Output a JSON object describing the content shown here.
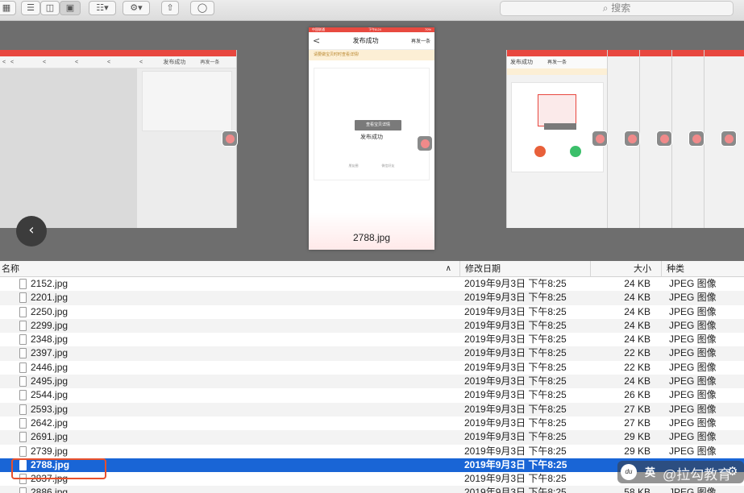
{
  "toolbar": {
    "search_placeholder": "搜索",
    "search_icon": "⌕"
  },
  "coverflow": {
    "caption": "2788.jpg",
    "phone": {
      "title": "发布成功",
      "back": "<",
      "more": "再发一条",
      "status_left": "中国联通",
      "status_time": "下午8:24",
      "status_right": "70%",
      "tip": "请要做宝贝时时查看详情!",
      "view_button": "查看宝贝详情",
      "done_text": "发布成功",
      "link_left": "朋友圈",
      "link_right": "微信好友"
    },
    "back_icon": "‹"
  },
  "columns": {
    "name": "名称",
    "sort_icon": "∧",
    "date": "修改日期",
    "size": "大小",
    "kind": "种类"
  },
  "files": [
    {
      "name": "2152.jpg",
      "date": "2019年9月3日 下午8:25",
      "size": "24 KB",
      "kind": "JPEG 图像"
    },
    {
      "name": "2201.jpg",
      "date": "2019年9月3日 下午8:25",
      "size": "24 KB",
      "kind": "JPEG 图像"
    },
    {
      "name": "2250.jpg",
      "date": "2019年9月3日 下午8:25",
      "size": "24 KB",
      "kind": "JPEG 图像"
    },
    {
      "name": "2299.jpg",
      "date": "2019年9月3日 下午8:25",
      "size": "24 KB",
      "kind": "JPEG 图像"
    },
    {
      "name": "2348.jpg",
      "date": "2019年9月3日 下午8:25",
      "size": "24 KB",
      "kind": "JPEG 图像"
    },
    {
      "name": "2397.jpg",
      "date": "2019年9月3日 下午8:25",
      "size": "22 KB",
      "kind": "JPEG 图像"
    },
    {
      "name": "2446.jpg",
      "date": "2019年9月3日 下午8:25",
      "size": "22 KB",
      "kind": "JPEG 图像"
    },
    {
      "name": "2495.jpg",
      "date": "2019年9月3日 下午8:25",
      "size": "24 KB",
      "kind": "JPEG 图像"
    },
    {
      "name": "2544.jpg",
      "date": "2019年9月3日 下午8:25",
      "size": "26 KB",
      "kind": "JPEG 图像"
    },
    {
      "name": "2593.jpg",
      "date": "2019年9月3日 下午8:25",
      "size": "27 KB",
      "kind": "JPEG 图像"
    },
    {
      "name": "2642.jpg",
      "date": "2019年9月3日 下午8:25",
      "size": "27 KB",
      "kind": "JPEG 图像"
    },
    {
      "name": "2691.jpg",
      "date": "2019年9月3日 下午8:25",
      "size": "29 KB",
      "kind": "JPEG 图像"
    },
    {
      "name": "2739.jpg",
      "date": "2019年9月3日 下午8:25",
      "size": "29 KB",
      "kind": "JPEG 图像"
    },
    {
      "name": "2788.jpg",
      "date": "2019年9月3日 下午8:25",
      "size": "",
      "kind": "",
      "selected": true
    },
    {
      "name": "2837.jpg",
      "date": "2019年9月3日 下午8:25",
      "size": "",
      "kind": ""
    },
    {
      "name": "2886.jpg",
      "date": "2019年9月3日 下午8:25",
      "size": "58 KB",
      "kind": "JPEG 图像"
    }
  ],
  "watermark": {
    "logo": "du",
    "lang": "英",
    "text": "@拉勾教育",
    "gear_icon": "⚙"
  },
  "colors": {
    "selection": "#1965d6",
    "highlight_box": "#e8502c",
    "phone_status": "#e84a40"
  }
}
